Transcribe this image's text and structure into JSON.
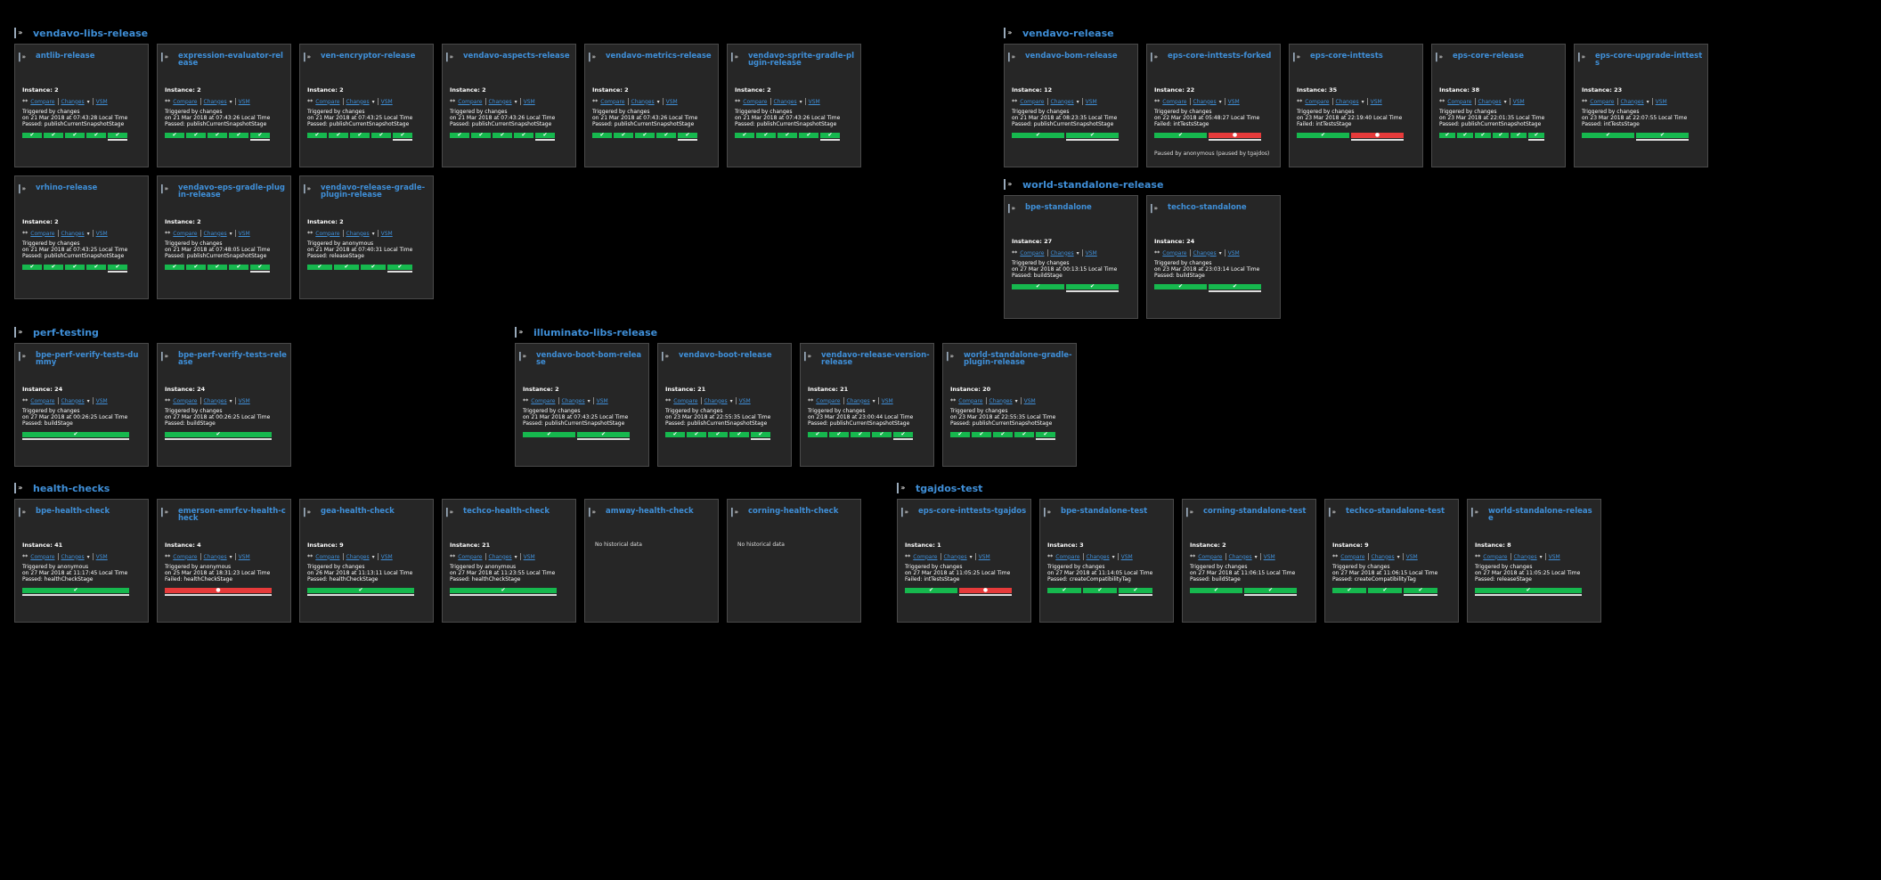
{
  "groups": [
    {
      "title": "vendavo-libs-release",
      "cards": [
        {
          "name": "antlib-release",
          "instance": "Instance: 2",
          "star": "**",
          "compare": "Compare",
          "changes": "Changes",
          "vsm": "VSM",
          "triggered": "Triggered by changes",
          "time": "on 21 Mar 2018 at 07:43:28 Local Time",
          "status": "Passed: publishCurrentSnapshotStage",
          "stages": [
            "ok",
            "ok",
            "ok",
            "ok",
            "ok"
          ]
        },
        {
          "name": "expression-evaluator-release",
          "instance": "Instance: 2",
          "star": "**",
          "compare": "Compare",
          "changes": "Changes",
          "vsm": "VSM",
          "triggered": "Triggered by changes",
          "time": "on 21 Mar 2018 at 07:43:26 Local Time",
          "status": "Passed: publishCurrentSnapshotStage",
          "stages": [
            "ok",
            "ok",
            "ok",
            "ok",
            "ok"
          ]
        },
        {
          "name": "ven-encryptor-release",
          "instance": "Instance: 2",
          "star": "**",
          "compare": "Compare",
          "changes": "Changes",
          "vsm": "VSM",
          "triggered": "Triggered by changes",
          "time": "on 21 Mar 2018 at 07:43:25 Local Time",
          "status": "Passed: publishCurrentSnapshotStage",
          "stages": [
            "ok",
            "ok",
            "ok",
            "ok",
            "ok"
          ]
        },
        {
          "name": "vendavo-aspects-release",
          "instance": "Instance: 2",
          "star": "**",
          "compare": "Compare",
          "changes": "Changes",
          "vsm": "VSM",
          "triggered": "Triggered by changes",
          "time": "on 21 Mar 2018 at 07:43:26 Local Time",
          "status": "Passed: publishCurrentSnapshotStage",
          "stages": [
            "ok",
            "ok",
            "ok",
            "ok",
            "ok"
          ]
        },
        {
          "name": "vendavo-metrics-release",
          "instance": "Instance: 2",
          "star": "**",
          "compare": "Compare",
          "changes": "Changes",
          "vsm": "VSM",
          "triggered": "Triggered by changes",
          "time": "on 21 Mar 2018 at 07:43:26 Local Time",
          "status": "Passed: publishCurrentSnapshotStage",
          "stages": [
            "ok",
            "ok",
            "ok",
            "ok",
            "ok"
          ]
        },
        {
          "name": "vendavo-sprite-gradle-plugin-release",
          "instance": "Instance: 2",
          "star": "**",
          "compare": "Compare",
          "changes": "Changes",
          "vsm": "VSM",
          "triggered": "Triggered by changes",
          "time": "on 21 Mar 2018 at 07:43:26 Local Time",
          "status": "Passed: publishCurrentSnapshotStage",
          "stages": [
            "ok",
            "ok",
            "ok",
            "ok",
            "ok"
          ]
        },
        {
          "name": "vrhino-release",
          "instance": "Instance: 2",
          "star": "**",
          "compare": "Compare",
          "changes": "Changes",
          "vsm": "VSM",
          "triggered": "Triggered by changes",
          "time": "on 21 Mar 2018 at 07:43:25 Local Time",
          "status": "Passed: publishCurrentSnapshotStage",
          "stages": [
            "ok",
            "ok",
            "ok",
            "ok",
            "ok"
          ]
        },
        {
          "name": "vendavo-eps-gradle-plugin-release",
          "instance": "Instance: 2",
          "star": "**",
          "compare": "Compare",
          "changes": "Changes",
          "vsm": "VSM",
          "triggered": "Triggered by changes",
          "time": "on 21 Mar 2018 at 07:48:05 Local Time",
          "status": "Passed: publishCurrentSnapshotStage",
          "stages": [
            "ok",
            "ok",
            "ok",
            "ok",
            "ok"
          ]
        },
        {
          "name": "vendavo-release-gradle-plugin-release",
          "instance": "Instance: 2",
          "star": "**",
          "compare": "Compare",
          "changes": "Changes",
          "vsm": "VSM",
          "triggered": "Triggered by anonymous",
          "time": "on 21 Mar 2018 at 07:40:31 Local Time",
          "status": "Passed: releaseStage",
          "stages": [
            "ok",
            "ok",
            "ok",
            "ok"
          ]
        }
      ]
    },
    {
      "title": "vendavo-release",
      "cards": [
        {
          "name": "vendavo-bom-release",
          "instance": "Instance: 12",
          "star": "**",
          "compare": "Compare",
          "changes": "Changes",
          "vsm": "VSM",
          "triggered": "Triggered by changes",
          "time": "on 21 Mar 2018 at 08:23:35 Local Time",
          "status": "Passed: publishCurrentSnapshotStage",
          "stages": [
            "ok",
            "ok"
          ]
        },
        {
          "name": "eps-core-inttests-forked",
          "instance": "Instance: 22",
          "star": "**",
          "compare": "Compare",
          "changes": "Changes",
          "vsm": "VSM",
          "triggered": "Triggered by changes",
          "time": "on 22 Mar 2018 at 05:48:27 Local Time",
          "status": "Failed: intTestsStage",
          "stages": [
            "ok",
            "fail"
          ],
          "paused": "Paused by anonymous (paused by tgajdos)"
        },
        {
          "name": "eps-core-inttests",
          "instance": "Instance: 35",
          "star": "**",
          "compare": "Compare",
          "changes": "Changes",
          "vsm": "VSM",
          "triggered": "Triggered by changes",
          "time": "on 23 Mar 2018 at 22:19:40 Local Time",
          "status": "Failed: intTestsStage",
          "stages": [
            "ok",
            "fail"
          ]
        },
        {
          "name": "eps-core-release",
          "instance": "Instance: 38",
          "star": "**",
          "compare": "Compare",
          "changes": "Changes",
          "vsm": "VSM",
          "triggered": "Triggered by changes",
          "time": "on 23 Mar 2018 at 22:01:35 Local Time",
          "status": "Passed: publishCurrentSnapshotStage",
          "stages": [
            "ok",
            "ok",
            "ok",
            "ok",
            "ok",
            "ok"
          ]
        },
        {
          "name": "eps-core-upgrade-inttests",
          "instance": "Instance: 23",
          "star": "**",
          "compare": "Compare",
          "changes": "Changes",
          "vsm": "VSM",
          "triggered": "Triggered by changes",
          "time": "on 23 Mar 2018 at 22:07:55 Local Time",
          "status": "Passed: intTestsStage",
          "stages": [
            "ok",
            "ok"
          ]
        }
      ]
    },
    {
      "title": "world-standalone-release",
      "cards": [
        {
          "name": "bpe-standalone",
          "instance": "Instance: 27",
          "star": "**",
          "compare": "Compare",
          "changes": "Changes",
          "vsm": "VSM",
          "triggered": "Triggered by changes",
          "time": "on 27 Mar 2018 at 00:13:15 Local Time",
          "status": "Passed: buildStage",
          "stages": [
            "ok",
            "ok"
          ]
        },
        {
          "name": "techco-standalone",
          "instance": "Instance: 24",
          "star": "**",
          "compare": "Compare",
          "changes": "Changes",
          "vsm": "VSM",
          "triggered": "Triggered by changes",
          "time": "on 23 Mar 2018 at 23:03:14 Local Time",
          "status": "Passed: buildStage",
          "stages": [
            "ok",
            "ok"
          ]
        }
      ]
    },
    {
      "title": "perf-testing",
      "cards": [
        {
          "name": "bpe-perf-verify-tests-dummy",
          "instance": "Instance: 24",
          "star": "**",
          "compare": "Compare",
          "changes": "Changes",
          "vsm": "VSM",
          "triggered": "Triggered by changes",
          "time": "on 27 Mar 2018 at 00:26:25 Local Time",
          "status": "Passed: buildStage",
          "stages": [
            "ok"
          ]
        },
        {
          "name": "bpe-perf-verify-tests-release",
          "instance": "Instance: 24",
          "star": "**",
          "compare": "Compare",
          "changes": "Changes",
          "vsm": "VSM",
          "triggered": "Triggered by changes",
          "time": "on 27 Mar 2018 at 00:26:25 Local Time",
          "status": "Passed: buildStage",
          "stages": [
            "ok"
          ]
        }
      ]
    },
    {
      "title": "illuminato-libs-release",
      "cards": [
        {
          "name": "vendavo-boot-bom-release",
          "instance": "Instance: 2",
          "star": "**",
          "compare": "Compare",
          "changes": "Changes",
          "vsm": "VSM",
          "triggered": "Triggered by changes",
          "time": "on 21 Mar 2018 at 07:43:25 Local Time",
          "status": "Passed: publishCurrentSnapshotStage",
          "stages": [
            "ok",
            "ok"
          ]
        },
        {
          "name": "vendavo-boot-release",
          "instance": "Instance: 21",
          "star": "**",
          "compare": "Compare",
          "changes": "Changes",
          "vsm": "VSM",
          "triggered": "Triggered by changes",
          "time": "on 23 Mar 2018 at 22:55:35 Local Time",
          "status": "Passed: publishCurrentSnapshotStage",
          "stages": [
            "ok",
            "ok",
            "ok",
            "ok",
            "ok"
          ]
        },
        {
          "name": "vendavo-release-version-release",
          "instance": "Instance: 21",
          "star": "**",
          "compare": "Compare",
          "changes": "Changes",
          "vsm": "VSM",
          "triggered": "Triggered by changes",
          "time": "on 23 Mar 2018 at 23:00:44 Local Time",
          "status": "Passed: publishCurrentSnapshotStage",
          "stages": [
            "ok",
            "ok",
            "ok",
            "ok",
            "ok"
          ]
        },
        {
          "name": "world-standalone-gradle-plugin-release",
          "instance": "Instance: 20",
          "star": "**",
          "compare": "Compare",
          "changes": "Changes",
          "vsm": "VSM",
          "triggered": "Triggered by changes",
          "time": "on 23 Mar 2018 at 22:55:35 Local Time",
          "status": "Passed: publishCurrentSnapshotStage",
          "stages": [
            "ok",
            "ok",
            "ok",
            "ok",
            "ok"
          ]
        }
      ]
    },
    {
      "title": "health-checks",
      "cards": [
        {
          "name": "bpe-health-check",
          "instance": "Instance: 41",
          "star": "**",
          "compare": "Compare",
          "changes": "Changes",
          "vsm": "VSM",
          "triggered": "Triggered by anonymous",
          "time": "on 27 Mar 2018 at 11:17:45 Local Time",
          "status": "Passed: healthCheckStage",
          "stages": [
            "ok"
          ]
        },
        {
          "name": "emerson-emrfcv-health-check",
          "instance": "Instance: 4",
          "star": "**",
          "compare": "Compare",
          "changes": "Changes",
          "vsm": "VSM",
          "triggered": "Triggered by anonymous",
          "time": "on 25 Mar 2018 at 18:31:23 Local Time",
          "status": "Failed: healthCheckStage",
          "stages": [
            "fail"
          ]
        },
        {
          "name": "gea-health-check",
          "instance": "Instance: 9",
          "star": "**",
          "compare": "Compare",
          "changes": "Changes",
          "vsm": "VSM",
          "triggered": "Triggered by changes",
          "time": "on 26 Mar 2018 at 11:13:11 Local Time",
          "status": "Passed: healthCheckStage",
          "stages": [
            "ok"
          ]
        },
        {
          "name": "techco-health-check",
          "instance": "Instance: 21",
          "star": "**",
          "compare": "Compare",
          "changes": "Changes",
          "vsm": "VSM",
          "triggered": "Triggered by anonymous",
          "time": "on 27 Mar 2018 at 11:23:55 Local Time",
          "status": "Passed: healthCheckStage",
          "stages": [
            "ok"
          ]
        },
        {
          "name": "amway-health-check",
          "nohistory": "No historical data"
        },
        {
          "name": "corning-health-check",
          "nohistory": "No historical data"
        }
      ]
    },
    {
      "title": "tgajdos-test",
      "cards": [
        {
          "name": "eps-core-inttests-tgajdos",
          "instance": "Instance: 1",
          "star": "**",
          "compare": "Compare",
          "changes": "Changes",
          "vsm": "VSM",
          "triggered": "Triggered by changes",
          "time": "on 27 Mar 2018 at 11:05:25 Local Time",
          "status": "Failed: intTestsStage",
          "stages": [
            "ok",
            "fail"
          ]
        },
        {
          "name": "bpe-standalone-test",
          "instance": "Instance: 3",
          "star": "**",
          "compare": "Compare",
          "changes": "Changes",
          "vsm": "VSM",
          "triggered": "Triggered by changes",
          "time": "on 27 Mar 2018 at 11:14:05 Local Time",
          "status": "Passed: createCompatibilityTag",
          "stages": [
            "ok",
            "ok",
            "ok"
          ]
        },
        {
          "name": "corning-standalone-test",
          "instance": "Instance: 2",
          "star": "**",
          "compare": "Compare",
          "changes": "Changes",
          "vsm": "VSM",
          "triggered": "Triggered by changes",
          "time": "on 27 Mar 2018 at 11:06:15 Local Time",
          "status": "Passed: buildStage",
          "stages": [
            "ok",
            "ok"
          ]
        },
        {
          "name": "techco-standalone-test",
          "instance": "Instance: 9",
          "star": "**",
          "compare": "Compare",
          "changes": "Changes",
          "vsm": "VSM",
          "triggered": "Triggered by changes",
          "time": "on 27 Mar 2018 at 11:06:15 Local Time",
          "status": "Passed: createCompatibilityTag",
          "stages": [
            "ok",
            "ok",
            "ok"
          ]
        },
        {
          "name": "world-standalone-release",
          "instance": "Instance: 8",
          "star": "**",
          "compare": "Compare",
          "changes": "Changes",
          "vsm": "VSM",
          "triggered": "Triggered by changes",
          "time": "on 27 Mar 2018 at 11:05:25 Local Time",
          "status": "Passed: releaseStage",
          "stages": [
            "ok"
          ]
        }
      ]
    }
  ],
  "icons": {
    "group": "pipeline-group-icon",
    "pipeline": "pipeline-icon",
    "stage_ok": "check-icon",
    "stage_fail": "failed-dot-icon",
    "changes_dropdown": "caret-down-icon"
  },
  "colors": {
    "link": "#3f8fd8",
    "passed": "#16b84e",
    "failed": "#e63a3a",
    "card_bg": "#262626",
    "page_bg": "#000000"
  }
}
